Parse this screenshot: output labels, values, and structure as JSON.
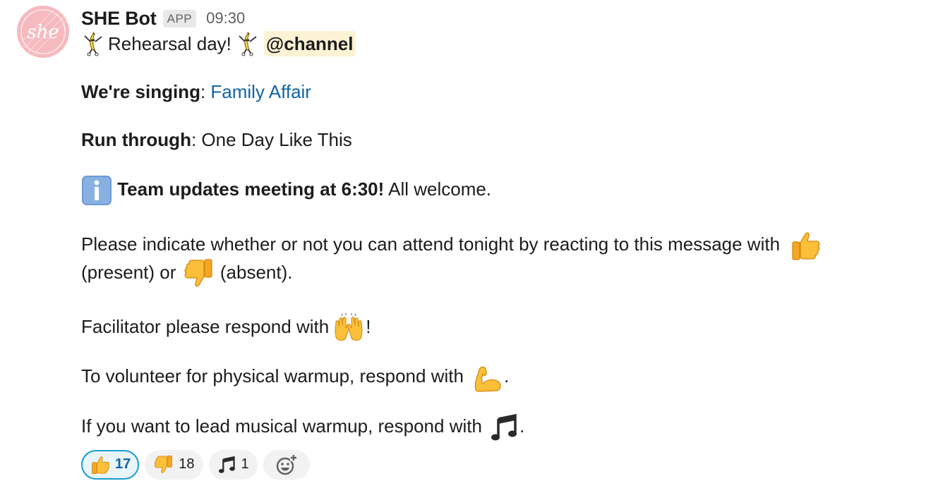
{
  "message": {
    "bot_name": "SHE Bot",
    "badge": "APP",
    "time": "09:30",
    "avatar_text": "she",
    "line1_text": "Rehearsal day!",
    "mention": "@channel",
    "singing_label": "We're singing",
    "singing_colon": ": ",
    "singing_link": "Family Affair",
    "run_label": "Run through",
    "run_value": ": One Day Like This",
    "team_bold": "Team updates meeting at 6:30!",
    "team_rest": " All welcome.",
    "indicate_part1": "Please indicate whether or not you can attend tonight by reacting to this message with",
    "indicate_present": "(present) or",
    "indicate_absent": "(absent).",
    "facilitator": "Facilitator please respond with",
    "facilitator_end": "!",
    "volunteer": "To volunteer for physical warmup, respond with",
    "volunteer_end": ".",
    "musical": "If you want to lead musical warmup, respond with",
    "musical_end": "."
  },
  "icons": {
    "dancing_banana": "dancing-banana-icon",
    "info": "information-icon",
    "thumbs_up": "thumbs-up-icon",
    "thumbs_down": "thumbs-down-icon",
    "raised_hands": "raised-hands-icon",
    "muscle": "flexed-biceps-icon",
    "notes": "musical-notes-icon",
    "add_reaction": "add-reaction-icon"
  },
  "reactions": [
    {
      "emoji": "thumbs-up",
      "count": "17",
      "active": true
    },
    {
      "emoji": "thumbs-down",
      "count": "18",
      "active": false
    },
    {
      "emoji": "musical-notes",
      "count": "1",
      "active": false
    }
  ],
  "colors": {
    "link": "#1264a3",
    "mention_bg": "#fdf2d4",
    "active_reaction_border": "#1d9bd1",
    "avatar_bg": "#f6b9bd"
  }
}
